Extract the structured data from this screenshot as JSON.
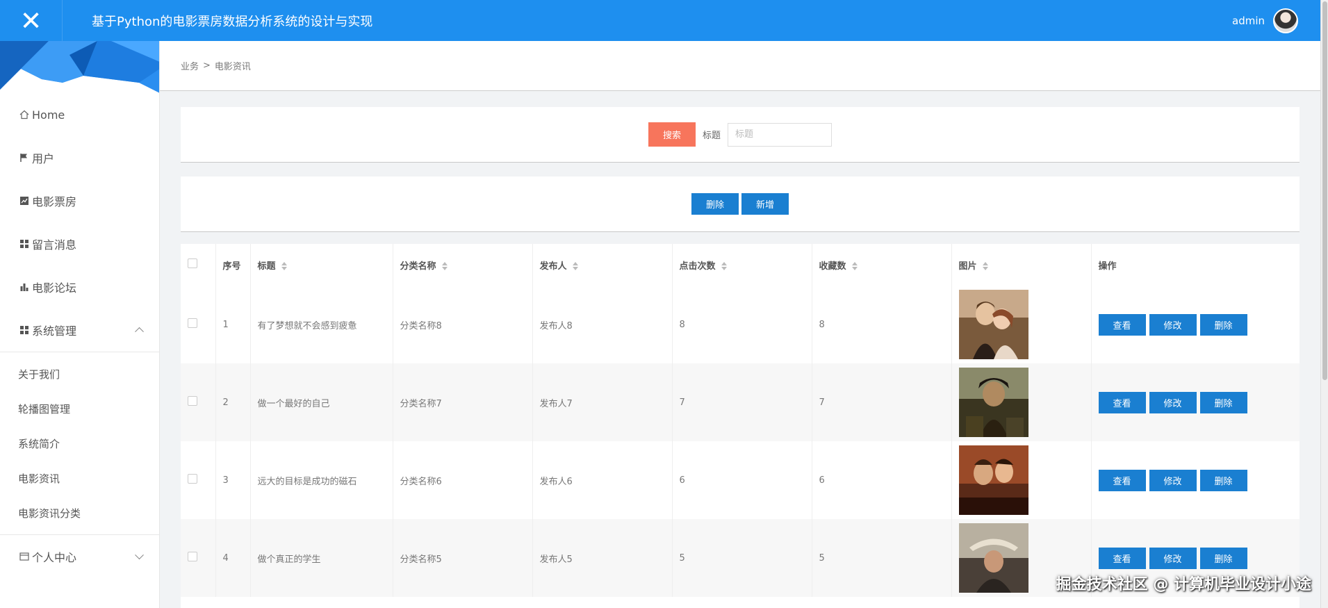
{
  "header": {
    "close_symbol": "✕",
    "title": "基于Python的电影票房数据分析系统的设计与实现",
    "username": "admin"
  },
  "sidebar": {
    "items": [
      {
        "label": "Home",
        "icon": "home-icon"
      },
      {
        "label": "用户",
        "icon": "flag-icon"
      },
      {
        "label": "电影票房",
        "icon": "chart-icon"
      },
      {
        "label": "留言消息",
        "icon": "grid-icon"
      },
      {
        "label": "电影论坛",
        "icon": "bar-chart-icon"
      },
      {
        "label": "系统管理",
        "icon": "grid-icon",
        "expanded": true
      }
    ],
    "subitems": [
      "关于我们",
      "轮播图管理",
      "系统简介",
      "电影资讯",
      "电影资讯分类"
    ],
    "footer_item": {
      "label": "个人中心",
      "icon": "card-icon"
    }
  },
  "breadcrumb": {
    "parent": "业务",
    "separator": ">",
    "current": "电影资讯"
  },
  "search": {
    "button": "搜索",
    "label": "标题",
    "placeholder": "标题",
    "value": ""
  },
  "actions": {
    "delete": "删除",
    "add": "新增"
  },
  "table": {
    "headers": {
      "index": "序号",
      "title": "标题",
      "category": "分类名称",
      "publisher": "发布人",
      "clicks": "点击次数",
      "favorites": "收藏数",
      "image": "图片",
      "ops": "操作"
    },
    "row_actions": {
      "view": "查看",
      "edit": "修改",
      "delete": "删除"
    },
    "rows": [
      {
        "index": "1",
        "title": "有了梦想就不会感到疲惫",
        "category": "分类名称8",
        "publisher": "发布人8",
        "clicks": "8",
        "favorites": "8"
      },
      {
        "index": "2",
        "title": "做一个最好的自己",
        "category": "分类名称7",
        "publisher": "发布人7",
        "clicks": "7",
        "favorites": "7"
      },
      {
        "index": "3",
        "title": "远大的目标是成功的磁石",
        "category": "分类名称6",
        "publisher": "发布人6",
        "clicks": "6",
        "favorites": "6"
      },
      {
        "index": "4",
        "title": "做个真正的学生",
        "category": "分类名称5",
        "publisher": "发布人5",
        "clicks": "5",
        "favorites": "5"
      }
    ]
  },
  "watermark": "掘金技术社区 @ 计算机毕业设计小途",
  "colors": {
    "header": "#1e8fef",
    "search_button": "#f7755c",
    "primary_button": "#1a7fd1"
  }
}
